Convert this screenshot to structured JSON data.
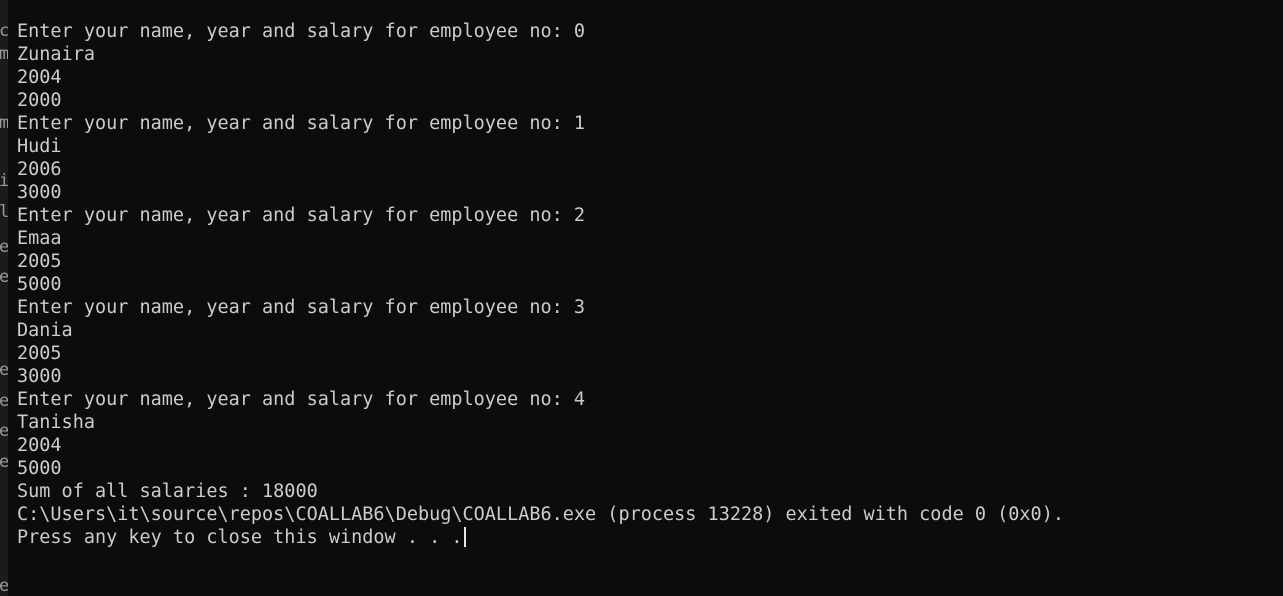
{
  "editor_gutter": [
    "c",
    "m",
    "",
    "m",
    "",
    "i",
    "l",
    "e",
    "e",
    "",
    "",
    "",
    "",
    "",
    "",
    "e",
    "e",
    "e",
    "e",
    "",
    "",
    "",
    "",
    "",
    "e"
  ],
  "console": {
    "lines": [
      "Enter your name, year and salary for employee no: 0",
      "Zunaira",
      "2004",
      "2000",
      "Enter your name, year and salary for employee no: 1",
      "Hudi",
      "2006",
      "3000",
      "Enter your name, year and salary for employee no: 2",
      "Emaa",
      "2005",
      "5000",
      "Enter your name, year and salary for employee no: 3",
      "Dania",
      "2005",
      "3000",
      "Enter your name, year and salary for employee no: 4",
      "Tanisha",
      "2004",
      "5000",
      "Sum of all salaries : 18000",
      "C:\\Users\\it\\source\\repos\\COALLAB6\\Debug\\COALLAB6.exe (process 13228) exited with code 0 (0x0).",
      "Press any key to close this window . . ."
    ]
  },
  "colors": {
    "background": "#0c0c0c",
    "text": "#cccccc"
  }
}
